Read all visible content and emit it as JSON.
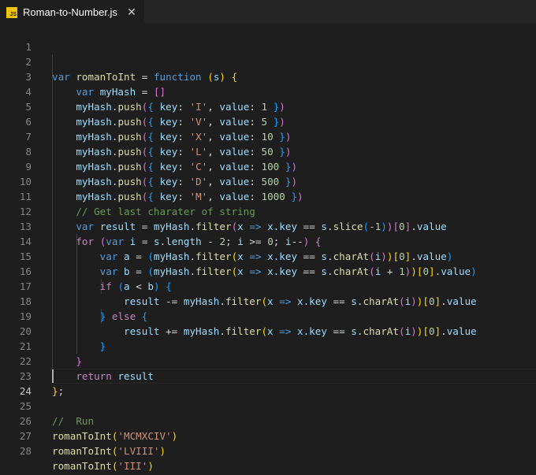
{
  "tab": {
    "icon_label": "JS",
    "title": "Roman-to-Number.js"
  },
  "editor": {
    "line_numbers": [
      "1",
      "2",
      "3",
      "4",
      "5",
      "6",
      "7",
      "8",
      "9",
      "10",
      "11",
      "12",
      "13",
      "14",
      "15",
      "16",
      "17",
      "18",
      "19",
      "20",
      "21",
      "22",
      "23",
      "24",
      "25",
      "26",
      "27",
      "28"
    ],
    "active_line": "24",
    "code": {
      "l2": [
        "var",
        "romanToInt",
        "=",
        "function",
        "(",
        "s",
        ")",
        "{"
      ],
      "l3": [
        "var",
        "myHash",
        "=",
        "[]"
      ],
      "push_lines": [
        {
          "obj": "myHash",
          "method": "push",
          "key": "key",
          "val_key": "value",
          "str": "'I'",
          "num": "1"
        },
        {
          "obj": "myHash",
          "method": "push",
          "key": "key",
          "val_key": "value",
          "str": "'V'",
          "num": "5"
        },
        {
          "obj": "myHash",
          "method": "push",
          "key": "key",
          "val_key": "value",
          "str": "'X'",
          "num": "10"
        },
        {
          "obj": "myHash",
          "method": "push",
          "key": "key",
          "val_key": "value",
          "str": "'L'",
          "num": "50"
        },
        {
          "obj": "myHash",
          "method": "push",
          "key": "key",
          "val_key": "value",
          "str": "'C'",
          "num": "100"
        },
        {
          "obj": "myHash",
          "method": "push",
          "key": "key",
          "val_key": "value",
          "str": "'D'",
          "num": "500"
        },
        {
          "obj": "myHash",
          "method": "push",
          "key": "key",
          "val_key": "value",
          "str": "'M'",
          "num": "1000"
        }
      ],
      "l11_comment": "// Get last charater of string",
      "l12": {
        "kw": "var",
        "result": "result",
        "eq": "=",
        "obj": "myHash",
        "filter": "filter",
        "x": "x",
        "arrow": "=>",
        "xkey": "x.key",
        "eqeq": "==",
        "s": "s",
        "slice": "slice",
        "neg": "-1",
        "idx": "0",
        "value": "value"
      },
      "l13": {
        "for": "for",
        "var": "var",
        "i": "i",
        "eq": "=",
        "s": "s",
        "length": "length",
        "minus": "-",
        "two": "2",
        "i2": "i",
        "gte": ">=",
        "zero": "0",
        "i3": "i",
        "dec": "--"
      },
      "l14": {
        "var": "var",
        "a": "a",
        "eq": "=",
        "obj": "myHash",
        "filter": "filter",
        "x": "x",
        "arrow": "=>",
        "xkey": "x.key",
        "eqeq": "==",
        "s": "s",
        "charAt": "charAt",
        "i": "i",
        "idx": "0",
        "value": "value"
      },
      "l15": {
        "var": "var",
        "b": "b",
        "eq": "=",
        "obj": "myHash",
        "filter": "filter",
        "x": "x",
        "arrow": "=>",
        "xkey": "x.key",
        "eqeq": "==",
        "s": "s",
        "charAt": "charAt",
        "i": "i",
        "plus": "+",
        "one": "1",
        "idx": "0",
        "value": "value"
      },
      "l16": {
        "if": "if",
        "a": "a",
        "lt": "<",
        "b": "b"
      },
      "l17": {
        "result": "result",
        "op": "-=",
        "obj": "myHash",
        "filter": "filter",
        "x": "x",
        "arrow": "=>",
        "xkey": "x.key",
        "eqeq": "==",
        "s": "s",
        "charAt": "charAt",
        "i": "i",
        "idx": "0",
        "value": "value"
      },
      "l18": {
        "else": "else"
      },
      "l19": {
        "result": "result",
        "op": "+=",
        "obj": "myHash",
        "filter": "filter",
        "x": "x",
        "arrow": "=>",
        "xkey": "x.key",
        "eqeq": "==",
        "s": "s",
        "charAt": "charAt",
        "i": "i",
        "idx": "0",
        "value": "value"
      },
      "l22": {
        "return": "return",
        "result": "result"
      },
      "l25_comment": "//  Run",
      "calls": [
        {
          "fn": "romanToInt",
          "arg": "'MCMXCIV'"
        },
        {
          "fn": "romanToInt",
          "arg": "'LVIII'"
        },
        {
          "fn": "romanToInt",
          "arg": "'III'"
        }
      ]
    }
  }
}
